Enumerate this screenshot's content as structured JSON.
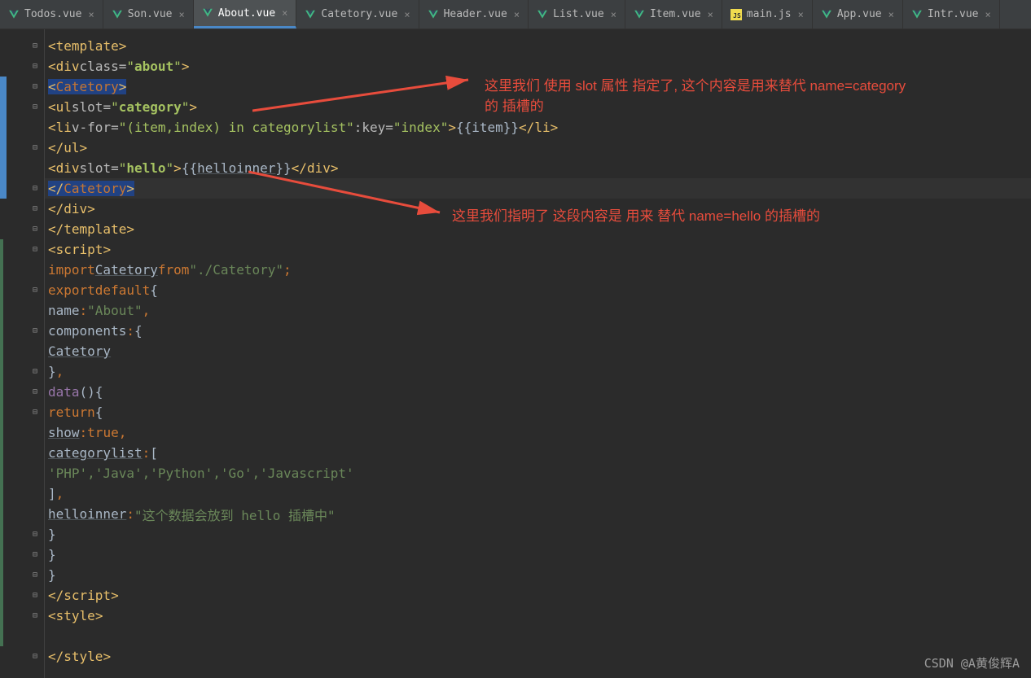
{
  "tabs": [
    {
      "label": "Todos.vue",
      "type": "vue",
      "active": false
    },
    {
      "label": "Son.vue",
      "type": "vue",
      "active": false
    },
    {
      "label": "About.vue",
      "type": "vue",
      "active": true
    },
    {
      "label": "Catetory.vue",
      "type": "vue",
      "active": false
    },
    {
      "label": "Header.vue",
      "type": "vue",
      "active": false
    },
    {
      "label": "List.vue",
      "type": "vue",
      "active": false
    },
    {
      "label": "Item.vue",
      "type": "vue",
      "active": false
    },
    {
      "label": "main.js",
      "type": "js",
      "active": false
    },
    {
      "label": "App.vue",
      "type": "vue",
      "active": false
    },
    {
      "label": "Intr.vue",
      "type": "vue",
      "active": false
    }
  ],
  "code": {
    "l1": {
      "tag": "template"
    },
    "l2": {
      "tag": "div",
      "attr": "class",
      "val": "about"
    },
    "l3": {
      "tag": "Catetory"
    },
    "l4": {
      "tag": "ul",
      "attr": "slot",
      "val": "category"
    },
    "l5": {
      "tag": "li",
      "a1": "v-for",
      "v1": "(item,index) in categorylist",
      "a2": ":key",
      "v2": "index",
      "expr": "item"
    },
    "l6": {
      "tag": "ul"
    },
    "l7": {
      "tag": "div",
      "attr": "slot",
      "val": "hello",
      "expr": "helloinner"
    },
    "l8": {
      "tag": "Catetory"
    },
    "l9": {
      "tag": "div"
    },
    "l10": {
      "tag": "template"
    },
    "l11": {
      "tag": "script"
    },
    "l12": {
      "kw1": "import",
      "id": "Catetory",
      "kw2": "from",
      "str": "\"./Catetory\""
    },
    "l13": {
      "kw1": "export",
      "kw2": "default"
    },
    "l14": {
      "key": "name",
      "val": "\"About\""
    },
    "l15": {
      "key": "components"
    },
    "l16": {
      "id": "Catetory"
    },
    "l18": {
      "key": "data"
    },
    "l19": {
      "kw": "return"
    },
    "l20": {
      "key": "show",
      "val": "true"
    },
    "l21": {
      "key": "categorylist"
    },
    "l22": {
      "arr": "'PHP','Java','Python','Go','Javascript'"
    },
    "l24": {
      "key": "helloinner",
      "val": "\"这个数据会放到 hello 插槽中\""
    },
    "l28": {
      "tag": "script"
    },
    "l29": {
      "tag": "style"
    },
    "l31": {
      "tag": "style"
    }
  },
  "annotations": {
    "a1": "这里我们 使用 slot 属性 指定了, 这个内容是用来替代  name=category 的  插槽的",
    "a2": "这里我们指明了 这段内容是 用来 替代 name=hello  的插槽的"
  },
  "watermark": "CSDN @A黄俊辉A"
}
